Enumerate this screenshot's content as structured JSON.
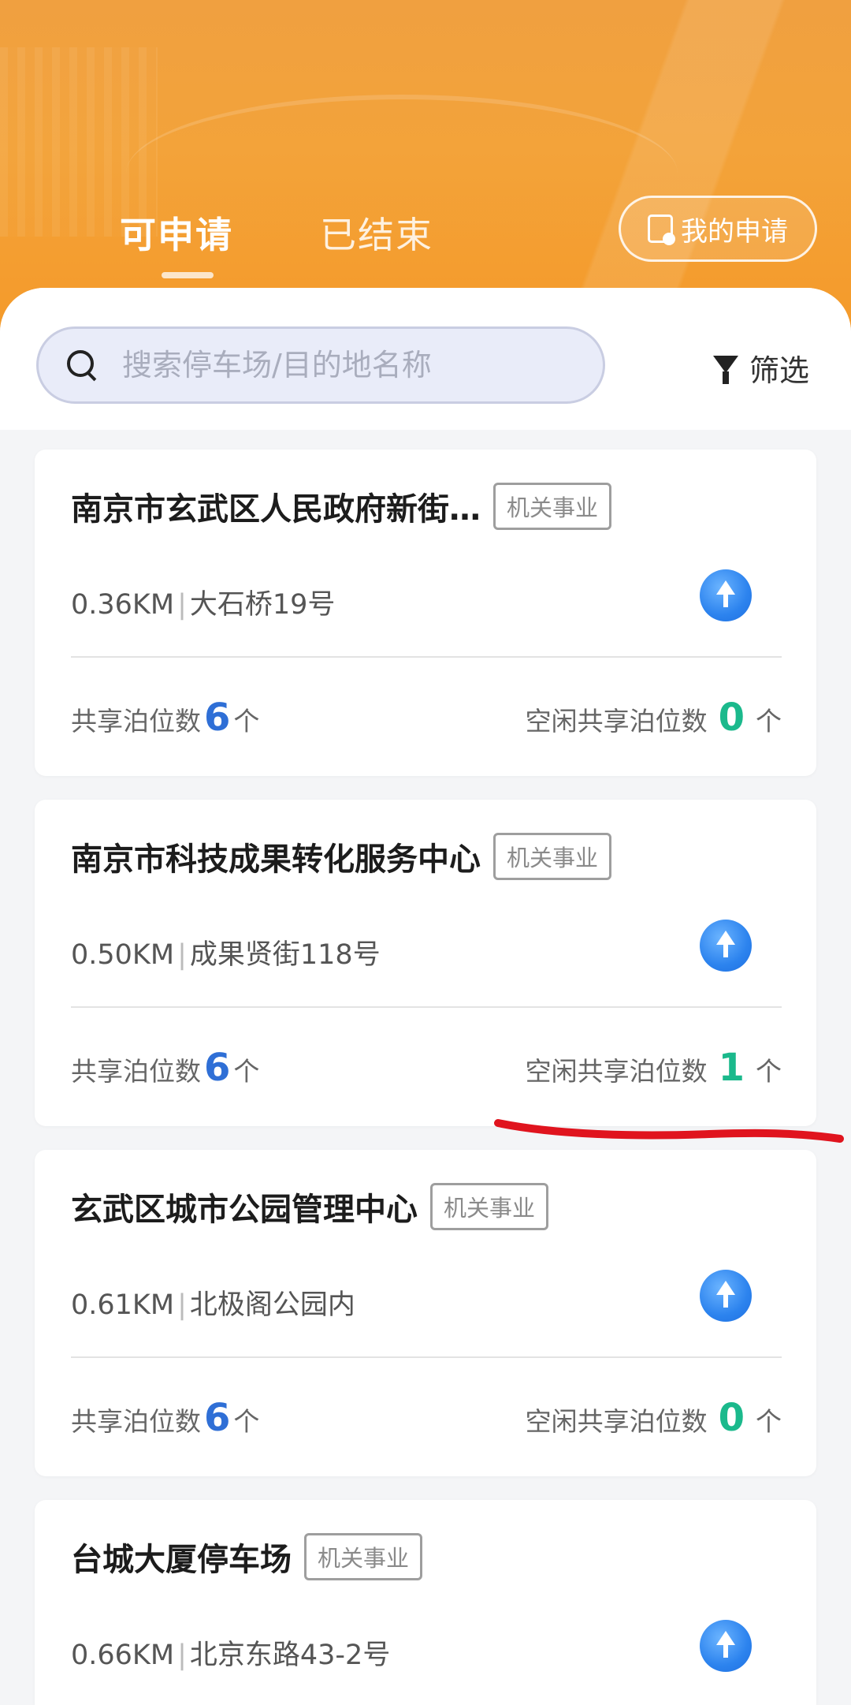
{
  "header": {
    "tabs": [
      {
        "label": "可申请",
        "active": true
      },
      {
        "label": "已结束",
        "active": false
      }
    ],
    "my_apply_label": "我的申请",
    "accent": "#f3a33a"
  },
  "search": {
    "placeholder": "搜索停车场/目的地名称",
    "value": ""
  },
  "filter_label": "筛选",
  "cards": [
    {
      "name": "南京市玄武区人民政府新街…",
      "tag": "机关事业",
      "distance": "0.36KM",
      "address": "大石桥19号",
      "shared_label": "共享泊位数",
      "shared_count": "6",
      "unit": "个",
      "free_label": "空闲共享泊位数",
      "free_count": "0"
    },
    {
      "name": "南京市科技成果转化服务中心",
      "tag": "机关事业",
      "distance": "0.50KM",
      "address": "成果贤街118号",
      "shared_label": "共享泊位数",
      "shared_count": "6",
      "unit": "个",
      "free_label": "空闲共享泊位数",
      "free_count": "1"
    },
    {
      "name": "玄武区城市公园管理中心",
      "tag": "机关事业",
      "distance": "0.61KM",
      "address": "北极阁公园内",
      "shared_label": "共享泊位数",
      "shared_count": "6",
      "unit": "个",
      "free_label": "空闲共享泊位数",
      "free_count": "0"
    },
    {
      "name": "台城大厦停车场",
      "tag": "机关事业",
      "distance": "0.66KM",
      "address": "北京东路43-2号"
    }
  ],
  "colors": {
    "count_blue": "#2f6fd6",
    "count_green": "#1bb98c",
    "annotation_red": "#e0141e"
  }
}
